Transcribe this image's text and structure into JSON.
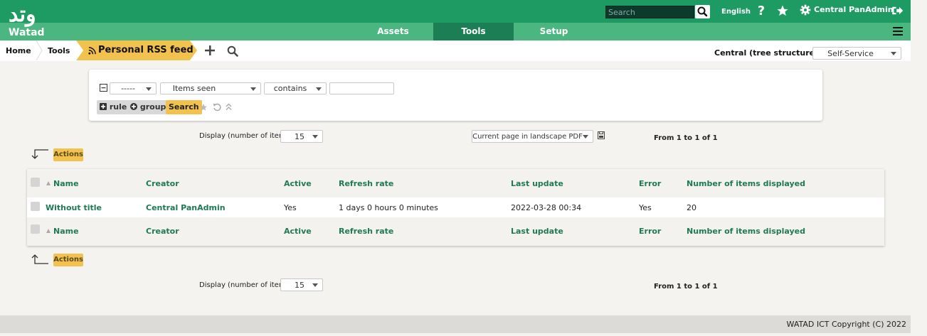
{
  "app": {
    "logo_text": "Watad",
    "logo_glyph": "وتد"
  },
  "header": {
    "search_placeholder": "Search",
    "language": "English",
    "user": "Central PanAdmin"
  },
  "menu": {
    "items": [
      {
        "label": "Assets"
      },
      {
        "label": "Tools"
      },
      {
        "label": "Setup"
      }
    ],
    "active": "Tools"
  },
  "breadcrumb": {
    "home": "Home",
    "tools": "Tools",
    "current": "Personal RSS feed"
  },
  "entity": {
    "label": "Central (tree structure)",
    "profile": "Self-Service"
  },
  "filter": {
    "field_empty": "-----",
    "field": "Items seen",
    "operator": "contains",
    "value": "",
    "rule_label": "rule",
    "group_label": "group",
    "search_label": "Search"
  },
  "pager": {
    "display_label": "Display (number of items)",
    "page_size": "15",
    "export_option": "Current page in landscape PDF",
    "range": "From 1 to 1 of 1"
  },
  "actions_label": "Actions",
  "table": {
    "columns": [
      "Name",
      "Creator",
      "Active",
      "Refresh rate",
      "Last update",
      "Error",
      "Number of items displayed"
    ],
    "rows": [
      [
        "Without title",
        "Central PanAdmin",
        "Yes",
        "1 days 0 hours 0 minutes",
        "2022-03-28 00:34",
        "Yes",
        "20"
      ]
    ]
  },
  "footer": {
    "copyright": "WATAD ICT Copyright (C) 2022"
  },
  "colors": {
    "primary": "#1e9a63",
    "menu": "#4bb680",
    "accent": "#f2c14e",
    "link": "#1e7a52"
  }
}
